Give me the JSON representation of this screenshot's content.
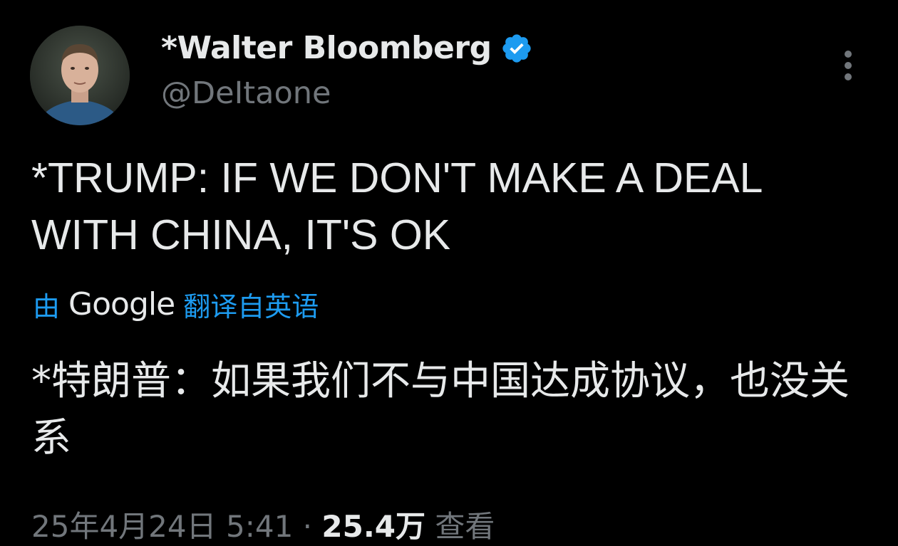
{
  "author": {
    "display_name": "*Walter Bloomberg",
    "handle": "@DeItaone",
    "verified": true,
    "verified_color": "#1d9bf0",
    "avatar_icon": "profile-photo"
  },
  "more_icon": "vertical-ellipsis",
  "tweet": {
    "text": "*TRUMP: IF WE DON'T MAKE A DEAL WITH CHINA, IT'S OK"
  },
  "translation": {
    "prefix": "由",
    "provider": "Google",
    "suffix": "翻译自英语",
    "text": "*特朗普：如果我们不与中国达成协议，也没关系",
    "link_color": "#1d9bf0"
  },
  "meta": {
    "date": "25年4月24日",
    "time": "5:41",
    "separator": "·",
    "views_count": "25.4万",
    "views_label": "查看"
  },
  "colors": {
    "background": "#000000",
    "primary_text": "#e7e9ea",
    "secondary_text": "#71767b"
  }
}
